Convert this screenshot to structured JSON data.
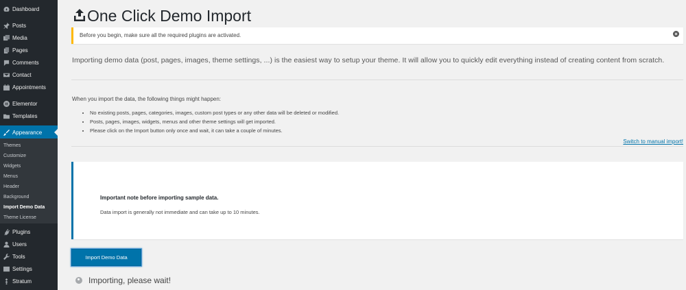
{
  "sidebar": {
    "items": [
      {
        "label": "Dashboard",
        "icon": "dashboard-icon"
      },
      {
        "label": "Posts",
        "icon": "pin-icon"
      },
      {
        "label": "Media",
        "icon": "media-icon"
      },
      {
        "label": "Pages",
        "icon": "pages-icon"
      },
      {
        "label": "Comments",
        "icon": "comments-icon"
      },
      {
        "label": "Contact",
        "icon": "mail-icon"
      },
      {
        "label": "Appointments",
        "icon": "calendar-icon"
      },
      {
        "label": "Elementor",
        "icon": "elementor-icon"
      },
      {
        "label": "Templates",
        "icon": "folder-icon"
      },
      {
        "label": "Appearance",
        "icon": "paintbrush-icon"
      },
      {
        "label": "Plugins",
        "icon": "plugin-icon"
      },
      {
        "label": "Users",
        "icon": "users-icon"
      },
      {
        "label": "Tools",
        "icon": "wrench-icon"
      },
      {
        "label": "Settings",
        "icon": "settings-icon"
      },
      {
        "label": "Stratum",
        "icon": "stratum-icon"
      }
    ],
    "submenu": [
      {
        "label": "Themes"
      },
      {
        "label": "Customize"
      },
      {
        "label": "Widgets"
      },
      {
        "label": "Menus"
      },
      {
        "label": "Header"
      },
      {
        "label": "Background"
      },
      {
        "label": "Import Demo Data"
      },
      {
        "label": "Theme License"
      }
    ],
    "active_item": "Appearance",
    "current_subitem": "Import Demo Data"
  },
  "page": {
    "title": "One Click Demo Import",
    "title_icon": "upload-icon"
  },
  "notice": {
    "text": "Before you begin, make sure all the required plugins are activated.",
    "close_icon": "dismiss-icon"
  },
  "intro": "Importing demo data (post, pages, images, theme settings, ...) is the easiest way to setup your theme. It will allow you to quickly edit everything instead of creating content from scratch.",
  "list": {
    "heading": "When you import the data, the following things might happen:",
    "items": [
      "No existing posts, pages, categories, images, custom post types or any other data will be deleted or modified.",
      "Posts, pages, images, widgets, menus and other theme settings will get imported.",
      "Please click on the Import button only once and wait, it can take a couple of minutes."
    ]
  },
  "manual_link": "Switch to manual import!",
  "note": {
    "title": "Important note before importing sample data.",
    "body": "Data import is generally not immediate and can take up to 10 minutes."
  },
  "import_button": "Import Demo Data",
  "status": "Importing, please wait!",
  "colors": {
    "sidebar_bg": "#23282d",
    "accent": "#0073aa",
    "notice_warning": "#ffb900",
    "page_bg": "#f1f1f1"
  }
}
